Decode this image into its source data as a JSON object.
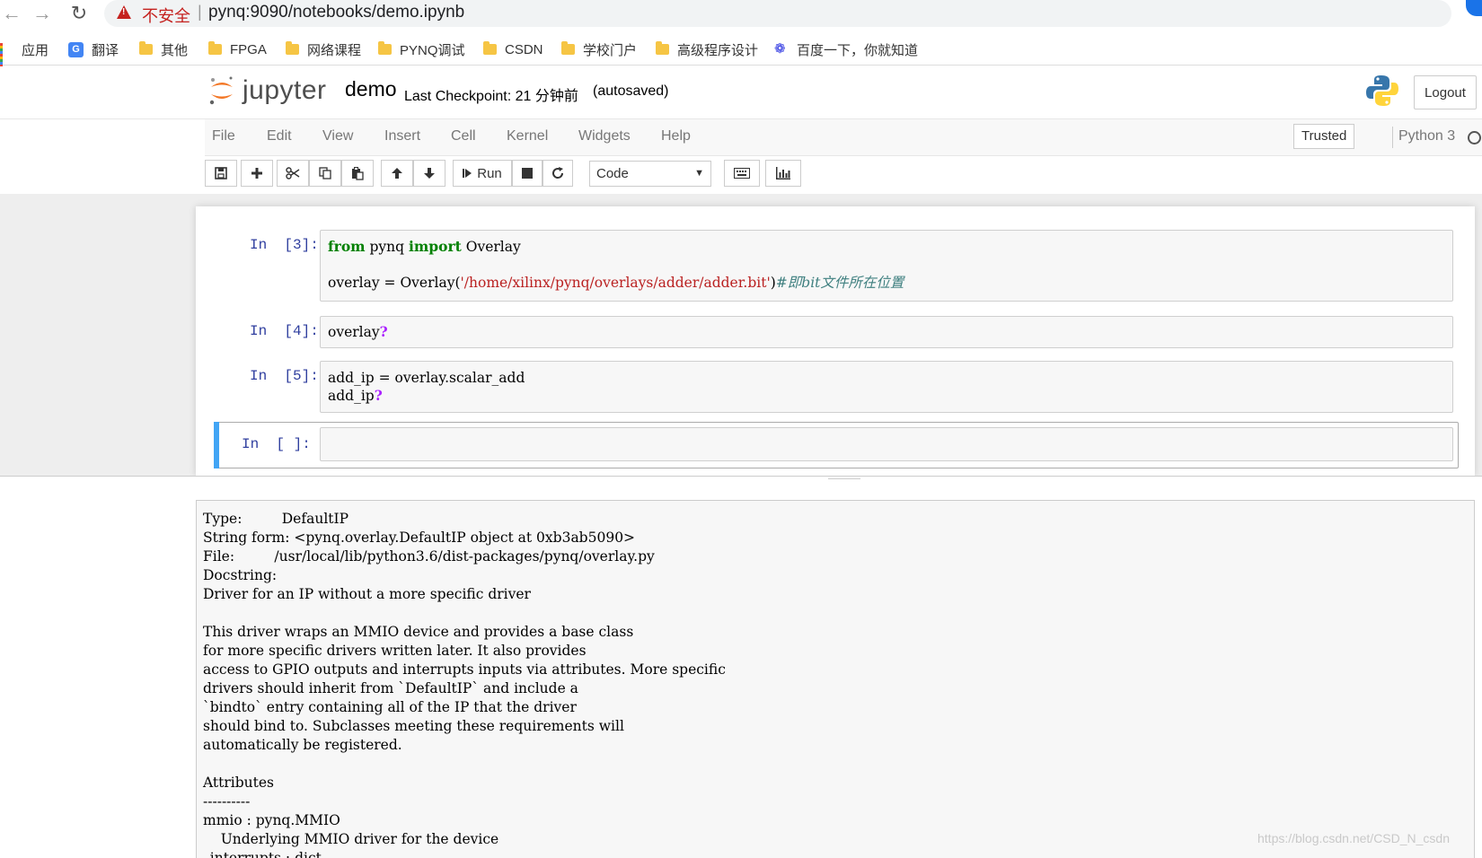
{
  "browser": {
    "security_label": "不安全",
    "separator": "|",
    "url": "pynq:9090/notebooks/demo.ipynb",
    "back_icon": "back-arrow-icon",
    "forward_icon": "forward-arrow-icon",
    "reload_icon": "reload-icon"
  },
  "bookmarks": [
    {
      "label": "应用",
      "icon": "apps-icon"
    },
    {
      "label": "翻译",
      "icon": "translate-icon"
    },
    {
      "label": "其他",
      "icon": "folder-icon"
    },
    {
      "label": "FPGA",
      "icon": "folder-icon"
    },
    {
      "label": "网络课程",
      "icon": "folder-icon"
    },
    {
      "label": "PYNQ调试",
      "icon": "folder-icon"
    },
    {
      "label": "CSDN",
      "icon": "folder-icon"
    },
    {
      "label": "学校门户",
      "icon": "folder-icon"
    },
    {
      "label": "高级程序设计",
      "icon": "folder-icon"
    },
    {
      "label": "百度一下，你就知道",
      "icon": "baidu-paw-icon"
    }
  ],
  "header": {
    "brand": "jupyter",
    "notebook_name": "demo",
    "checkpoint": "Last Checkpoint: 21 分钟前",
    "autosaved": "(autosaved)",
    "logout": "Logout"
  },
  "menubar": {
    "items": [
      "File",
      "Edit",
      "View",
      "Insert",
      "Cell",
      "Kernel",
      "Widgets",
      "Help"
    ],
    "trusted": "Trusted",
    "kernel": "Python 3"
  },
  "toolbar": {
    "run_label": "Run",
    "cell_type": "Code",
    "buttons": [
      "save-icon",
      "plus-icon",
      "cut-icon",
      "copy-icon",
      "paste-icon",
      "arrow-up-icon",
      "arrow-down-icon",
      "run-icon",
      "stop-icon",
      "restart-icon",
      "keyboard-icon",
      "chart-icon"
    ]
  },
  "cells": [
    {
      "prompt": "In  [3]:",
      "lines": [
        [
          {
            "t": "kw",
            "v": "from"
          },
          {
            "t": "",
            "v": " pynq "
          },
          {
            "t": "kw",
            "v": "import"
          },
          {
            "t": "",
            "v": " Overlay"
          }
        ],
        [],
        [
          {
            "t": "",
            "v": "overlay = Overlay("
          },
          {
            "t": "str",
            "v": "'/home/xilinx/pynq/overlays/adder/adder.bit'"
          },
          {
            "t": "",
            "v": ")"
          },
          {
            "t": "cm",
            "v": "#即bit文件所在位置"
          }
        ]
      ]
    },
    {
      "prompt": "In  [4]:",
      "lines": [
        [
          {
            "t": "",
            "v": "overlay"
          },
          {
            "t": "op",
            "v": "?"
          }
        ]
      ]
    },
    {
      "prompt": "In  [5]:",
      "lines": [
        [
          {
            "t": "",
            "v": "add_ip = overlay.scalar_add"
          }
        ],
        [
          {
            "t": "",
            "v": "add_ip"
          },
          {
            "t": "op",
            "v": "?"
          }
        ]
      ]
    },
    {
      "prompt": "In  [ ]:",
      "lines": []
    }
  ],
  "pager": {
    "lines": [
      "Type:         DefaultIP",
      "String form: <pynq.overlay.DefaultIP object at 0xb3ab5090>",
      "File:         /usr/local/lib/python3.6/dist-packages/pynq/overlay.py",
      "Docstring:",
      "Driver for an IP without a more specific driver",
      "",
      "This driver wraps an MMIO device and provides a base class",
      "for more specific drivers written later. It also provides",
      "access to GPIO outputs and interrupts inputs via attributes. More specific",
      "drivers should inherit from `DefaultIP` and include a",
      "`bindto` entry containing all of the IP that the driver",
      "should bind to. Subclasses meeting these requirements will",
      "automatically be registered.",
      "",
      "Attributes",
      "----------",
      "mmio : pynq.MMIO",
      "    Underlying MMIO driver for the device",
      "_interrupts : dict"
    ]
  },
  "watermark": "https://blog.csdn.net/CSD_N_csdn"
}
